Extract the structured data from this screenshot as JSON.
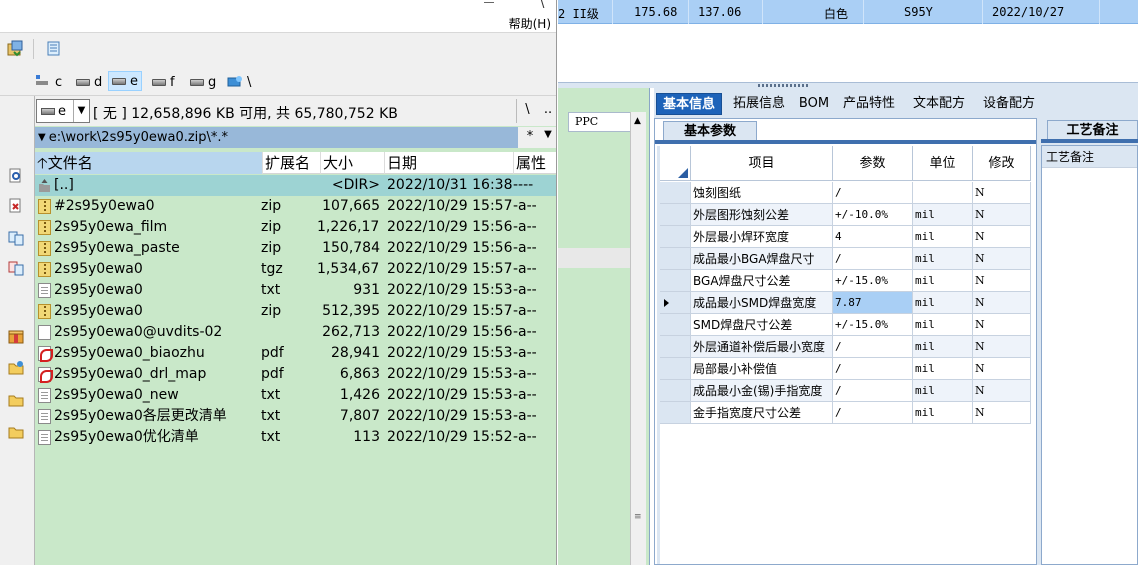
{
  "file_manager": {
    "menubar": {
      "slash": "\\",
      "help": "帮助(H)"
    },
    "drives": [
      {
        "letter": "c",
        "active": false
      },
      {
        "letter": "d",
        "active": false
      },
      {
        "letter": "e",
        "active": true
      },
      {
        "letter": "f",
        "active": false
      },
      {
        "letter": "g",
        "active": false
      },
      {
        "letter": "\\",
        "active": false
      }
    ],
    "panel": {
      "drive_letter": "e",
      "free_space": "[ 无 ]  12,658,896 KB 可用, 共 65,780,752 KB",
      "root_btn": "\\",
      "up_btn": "..",
      "path": "e:\\work\\2s95y0ewa0.zip\\*.*",
      "filter_star": "*",
      "history_arrow": "▼"
    },
    "columns": {
      "name": "文件名",
      "ext": "扩展名",
      "size": "大小",
      "date": "日期",
      "attr": "属性"
    },
    "files": [
      {
        "name": "[..]",
        "ext": "",
        "size": "<DIR>",
        "date": "2022/10/31 16:38",
        "attr": "----",
        "icon": "up"
      },
      {
        "name": "#2s95y0ewa0",
        "ext": "zip",
        "size": "107,665",
        "date": "2022/10/29 15:57",
        "attr": "-a--",
        "icon": "zip"
      },
      {
        "name": "2s95y0ewa_film",
        "ext": "zip",
        "size": "1,226,173",
        "date": "2022/10/29 15:56",
        "attr": "-a--",
        "icon": "zip"
      },
      {
        "name": "2s95y0ewa_paste",
        "ext": "zip",
        "size": "150,784",
        "date": "2022/10/29 15:56",
        "attr": "-a--",
        "icon": "zip"
      },
      {
        "name": "2s95y0ewa0",
        "ext": "tgz",
        "size": "1,534,676",
        "date": "2022/10/29 15:57",
        "attr": "-a--",
        "icon": "zip"
      },
      {
        "name": "2s95y0ewa0",
        "ext": "txt",
        "size": "931",
        "date": "2022/10/29 15:53",
        "attr": "-a--",
        "icon": "txt"
      },
      {
        "name": "2s95y0ewa0",
        "ext": "zip",
        "size": "512,395",
        "date": "2022/10/29 15:57",
        "attr": "-a--",
        "icon": "zip"
      },
      {
        "name": "2s95y0ewa0@uvdits-02",
        "ext": "",
        "size": "262,713",
        "date": "2022/10/29 15:56",
        "attr": "-a--",
        "icon": "file"
      },
      {
        "name": "2s95y0ewa0_biaozhu",
        "ext": "pdf",
        "size": "28,941",
        "date": "2022/10/29 15:53",
        "attr": "-a--",
        "icon": "pdf"
      },
      {
        "name": "2s95y0ewa0_drl_map",
        "ext": "pdf",
        "size": "6,863",
        "date": "2022/10/29 15:53",
        "attr": "-a--",
        "icon": "pdf"
      },
      {
        "name": "2s95y0ewa0_new",
        "ext": "txt",
        "size": "1,426",
        "date": "2022/10/29 15:53",
        "attr": "-a--",
        "icon": "txt"
      },
      {
        "name": "2s95y0ewa0各层更改清单",
        "ext": "txt",
        "size": "7,807",
        "date": "2022/10/29 15:53",
        "attr": "-a--",
        "icon": "txt"
      },
      {
        "name": "2s95y0ewa0优化清单",
        "ext": "txt",
        "size": "113",
        "date": "2022/10/29 15:52",
        "attr": "-a--",
        "icon": "txt"
      }
    ],
    "colors": {
      "panel_bg": "#c9e8c9",
      "path_bg": "#98b8d9",
      "parent_row": "#9dd3d3"
    }
  },
  "app": {
    "top_row": {
      "grade": "2 II级",
      "v1": "175.68",
      "v2": "137.06",
      "color": "白色",
      "code": "S95Y",
      "date": "2022/10/27"
    },
    "ppc_label": "PPC",
    "tabs": [
      {
        "label": "基本信息",
        "active": true
      },
      {
        "label": "拓展信息",
        "active": false
      },
      {
        "label": "BOM",
        "active": false
      },
      {
        "label": "产品特性",
        "active": false
      },
      {
        "label": "文本配方",
        "active": false
      },
      {
        "label": "设备配方",
        "active": false
      }
    ],
    "params_title": "基本参数",
    "craft_title": "工艺备注",
    "craft_label": "工艺备注",
    "grid_columns": {
      "item": "项目",
      "param": "参数",
      "unit": "单位",
      "mod": "修改"
    },
    "grid_rows": [
      {
        "item": "蚀刻图纸",
        "param": "/",
        "unit": "",
        "mod": "N"
      },
      {
        "item": "外层图形蚀刻公差",
        "param": "+/-10.0%",
        "unit": "mil",
        "mod": "N"
      },
      {
        "item": "外层最小焊环宽度",
        "param": "4",
        "unit": "mil",
        "mod": "N"
      },
      {
        "item": "成品最小BGA焊盘尺寸",
        "param": "/",
        "unit": "mil",
        "mod": "N"
      },
      {
        "item": "BGA焊盘尺寸公差",
        "param": "+/-15.0%",
        "unit": "mil",
        "mod": "N"
      },
      {
        "item": "成品最小SMD焊盘宽度",
        "param": "7.87",
        "unit": "mil",
        "mod": "N",
        "current": true
      },
      {
        "item": "SMD焊盘尺寸公差",
        "param": "+/-15.0%",
        "unit": "mil",
        "mod": "N"
      },
      {
        "item": "外层通道补偿后最小宽度",
        "param": "/",
        "unit": "mil",
        "mod": "N"
      },
      {
        "item": "局部最小补偿值",
        "param": "/",
        "unit": "mil",
        "mod": "N"
      },
      {
        "item": "成品最小金(锡)手指宽度",
        "param": "/",
        "unit": "mil",
        "mod": "N"
      },
      {
        "item": "金手指宽度尺寸公差",
        "param": "/",
        "unit": "mil",
        "mod": "N"
      }
    ],
    "colors": {
      "accent": "#1d63b9",
      "selection": "#a9cff5",
      "panel": "#dbe6f2"
    }
  }
}
